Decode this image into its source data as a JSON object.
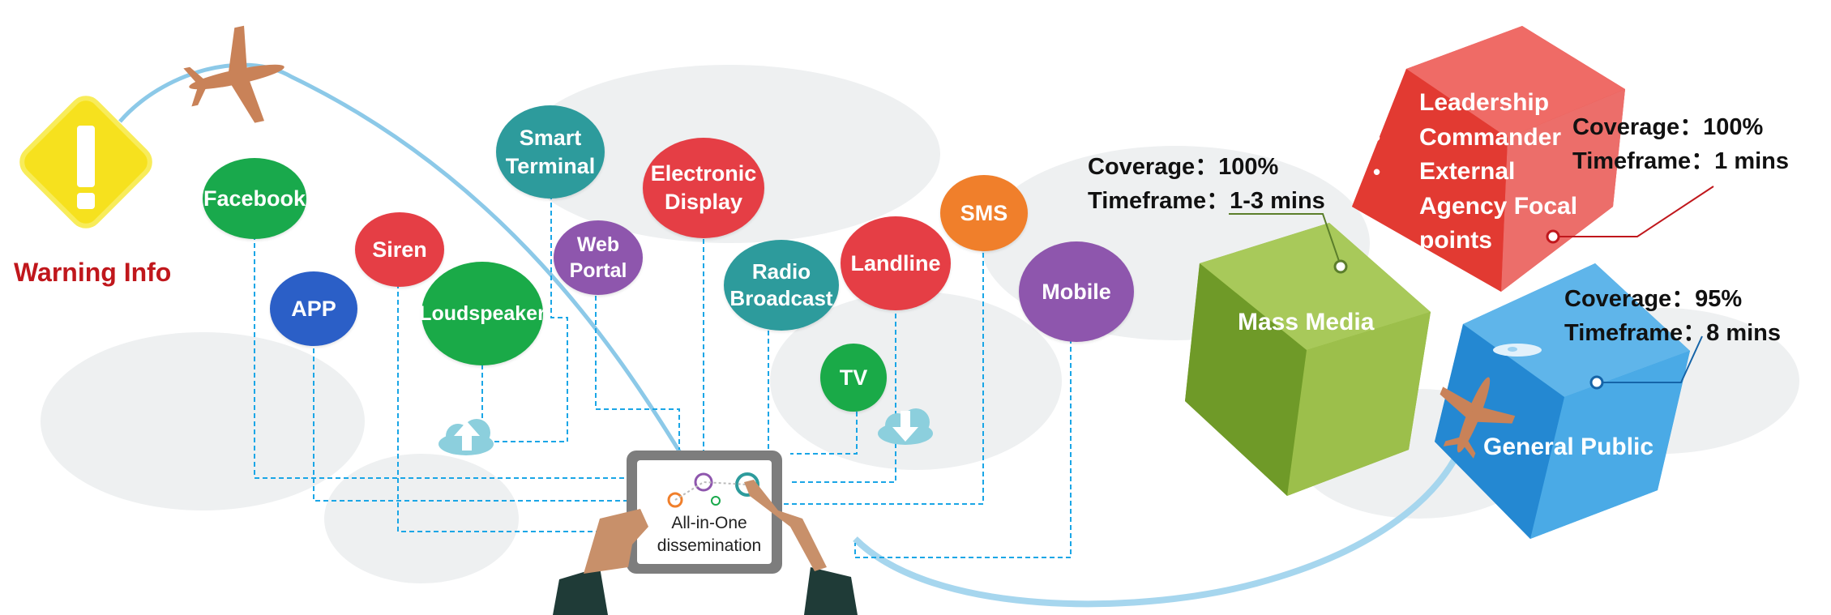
{
  "warning": {
    "label": "Warning Info",
    "icon": "warning-diamond-icon"
  },
  "channels": [
    {
      "id": "facebook",
      "label": "Facebook",
      "color": "#19a94c"
    },
    {
      "id": "app",
      "label": "APP",
      "color": "#2b5fc7"
    },
    {
      "id": "siren",
      "label": "Siren",
      "color": "#e53e45"
    },
    {
      "id": "loudspeaker",
      "label": "Loudspeaker",
      "color": "#1aaa48"
    },
    {
      "id": "smart-terminal",
      "label": "Smart Terminal",
      "color": "#2d9b9c"
    },
    {
      "id": "web-portal",
      "label": "Web Portal",
      "color": "#8e56ad"
    },
    {
      "id": "electronic-display",
      "label": "Electronic Display",
      "color": "#e53e45"
    },
    {
      "id": "radio-broadcast",
      "label": "Radio Broadcast",
      "color": "#2d9b9c"
    },
    {
      "id": "landline",
      "label": "Landline",
      "color": "#e53e45"
    },
    {
      "id": "sms",
      "label": "SMS",
      "color": "#f07f2b"
    },
    {
      "id": "tv",
      "label": "TV",
      "color": "#1aaa48"
    },
    {
      "id": "mobile",
      "label": "Mobile",
      "color": "#8e56ad"
    }
  ],
  "hub": {
    "label": "All-in-One dissemination"
  },
  "targets": {
    "mass_media": {
      "label": "Mass Media",
      "coverage": "Coverage：100%",
      "timeframe": "Timeframe：1-3 mins",
      "color": "#8db43a"
    },
    "leadership": {
      "items": [
        "Leadership",
        "Commander",
        "External",
        "Agency Focal",
        "points"
      ],
      "coverage": "Coverage：100%",
      "timeframe": "Timeframe：1 mins",
      "color": "#e8453d"
    },
    "general_public": {
      "label": "General Public",
      "coverage": "Coverage：95%",
      "timeframe": "Timeframe：8 mins",
      "color": "#2f9be0"
    }
  },
  "colors": {
    "connector": "#1aa6e6",
    "warning_text": "#c0171c",
    "flight_path": "#8cc9e8"
  }
}
